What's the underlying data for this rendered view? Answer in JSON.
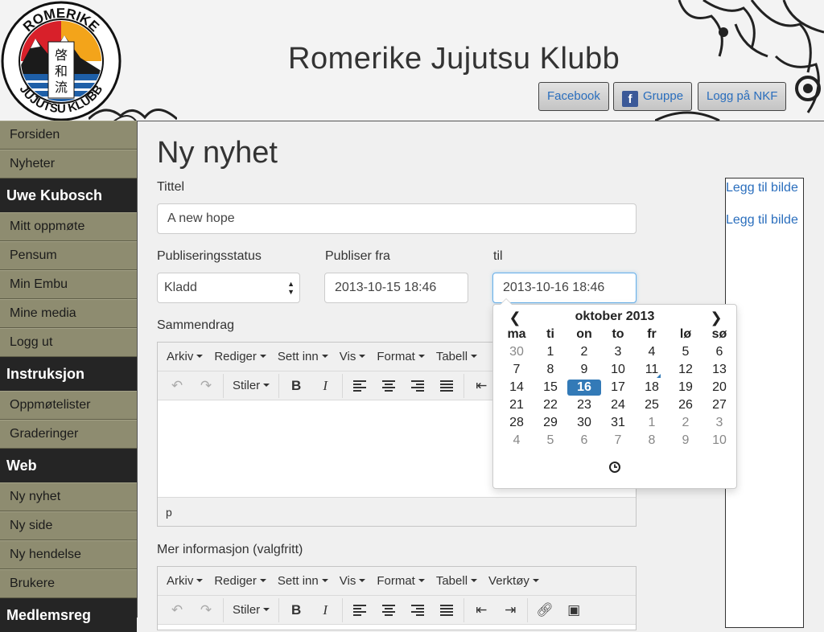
{
  "header": {
    "site_title": "Romerike Jujutsu Klubb",
    "logo_text_top": "ROMERIKE",
    "logo_text_bottom": "JUJUTSU KLUBB",
    "logo_kanji": [
      "啓",
      "和",
      "流"
    ],
    "buttons": [
      {
        "label": "Facebook"
      },
      {
        "label": "Gruppe",
        "icon": "facebook-icon"
      },
      {
        "label": "Logg på NKF"
      }
    ]
  },
  "sidebar": {
    "groups": [
      {
        "items": [
          "Forsiden",
          "Nyheter"
        ]
      },
      {
        "heading": "Uwe Kubosch",
        "items": [
          "Mitt oppmøte",
          "Pensum",
          "Min Embu",
          "Mine media",
          "Logg ut"
        ]
      },
      {
        "heading": "Instruksjon",
        "items": [
          "Oppmøtelister",
          "Graderinger"
        ]
      },
      {
        "heading": "Web",
        "items": [
          "Ny nyhet",
          "Ny side",
          "Ny hendelse",
          "Brukere"
        ]
      },
      {
        "heading": "Medlemsreg",
        "items": []
      }
    ]
  },
  "form": {
    "page_title": "Ny nyhet",
    "title_label": "Tittel",
    "title_value": "A new hope",
    "status_label": "Publiseringsstatus",
    "status_value": "Kladd",
    "publish_from_label": "Publiser fra",
    "publish_from_value": "2013-10-15 18:46",
    "publish_to_label": "til",
    "publish_to_value": "2013-10-16 18:46",
    "summary_label": "Sammendrag",
    "more_info_label": "Mer informasjon (valgfritt)"
  },
  "editor": {
    "menu": [
      "Arkiv",
      "Rediger",
      "Sett inn",
      "Vis",
      "Format",
      "Tabell"
    ],
    "menu_full": [
      "Arkiv",
      "Rediger",
      "Sett inn",
      "Vis",
      "Format",
      "Tabell",
      "Verktøy"
    ],
    "styles_label": "Stiler",
    "bold_label": "B",
    "italic_label": "I",
    "status_path": "p"
  },
  "side_panel": {
    "links": [
      "Legg til bilde",
      "Legg til bilde"
    ]
  },
  "datepicker": {
    "month_label": "oktober 2013",
    "weekdays": [
      "ma",
      "ti",
      "on",
      "to",
      "fr",
      "lø",
      "sø"
    ],
    "weeks": [
      [
        30,
        1,
        2,
        3,
        4,
        5,
        6
      ],
      [
        7,
        8,
        9,
        10,
        11,
        12,
        13
      ],
      [
        14,
        15,
        16,
        17,
        18,
        19,
        20
      ],
      [
        21,
        22,
        23,
        24,
        25,
        26,
        27
      ],
      [
        28,
        29,
        30,
        31,
        1,
        2,
        3
      ],
      [
        4,
        5,
        6,
        7,
        8,
        9,
        10
      ]
    ],
    "selected_day": 16,
    "today_day": 11,
    "accent_color": "#337ab7"
  },
  "colors": {
    "sidebar_bg": "#8e8c70",
    "sidebar_heading_bg": "#252525",
    "link": "#2a6ebd"
  }
}
